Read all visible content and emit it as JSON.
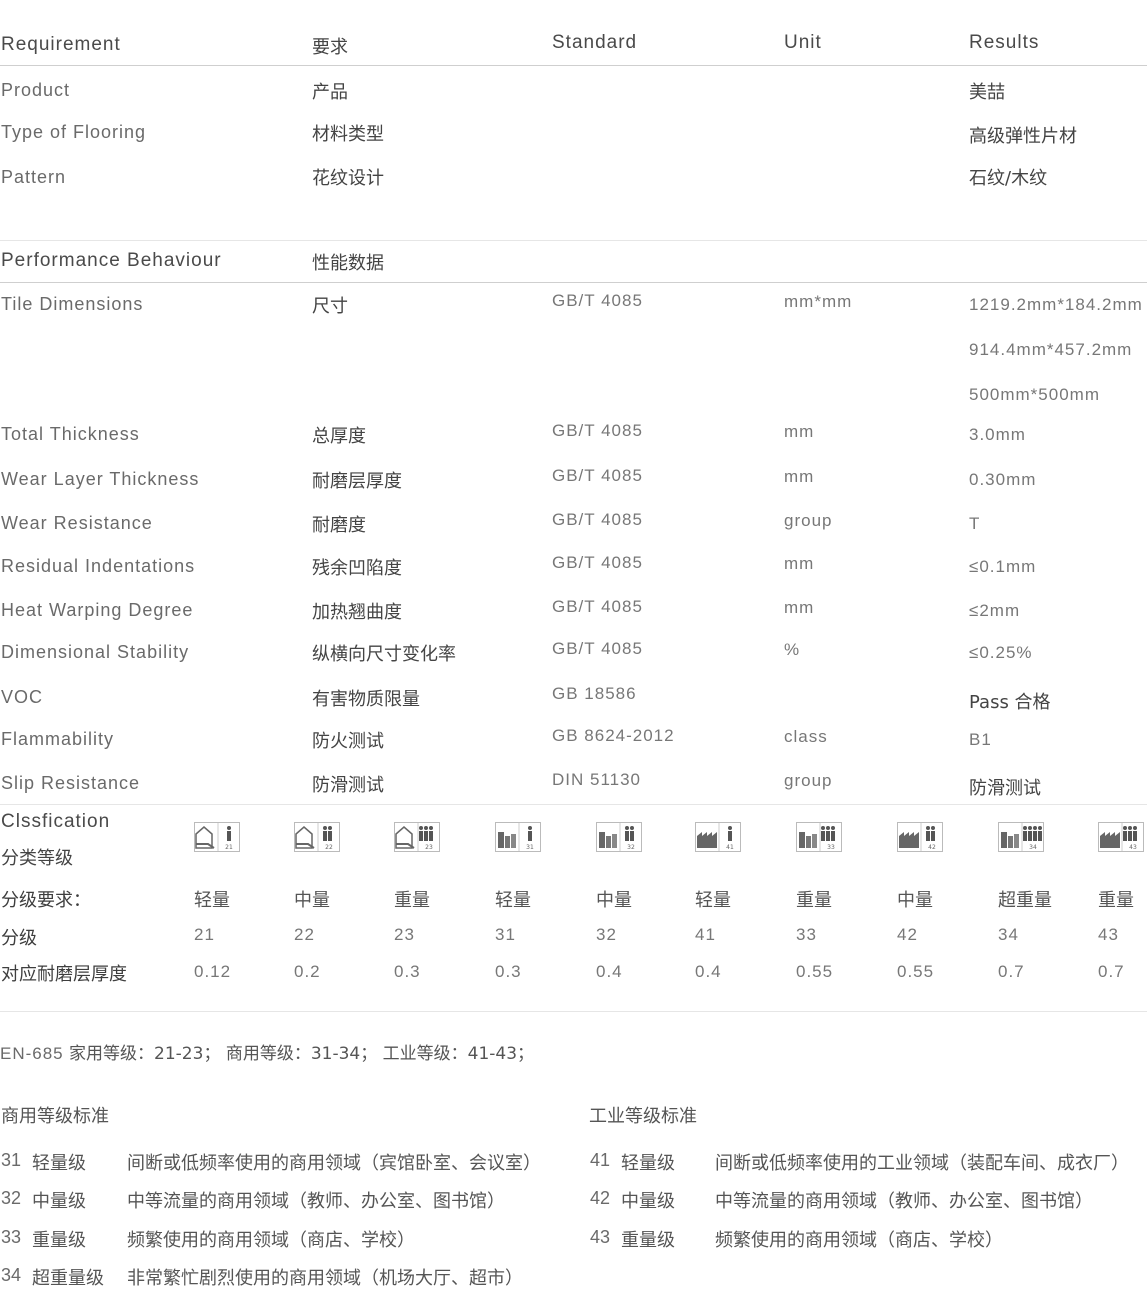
{
  "header": {
    "c1": "Requirement",
    "c2": "要求",
    "c3": "Standard",
    "c4": "Unit",
    "c5": "Results"
  },
  "basic": [
    {
      "en": "Product",
      "zh": "产品",
      "result": "美喆"
    },
    {
      "en": "Type of Flooring",
      "zh": "材料类型",
      "result": "高级弹性片材"
    },
    {
      "en": "Pattern",
      "zh": "花纹设计",
      "result": "石纹/木纹"
    }
  ],
  "perf_header": {
    "en": "Performance Behaviour",
    "zh": "性能数据"
  },
  "perf": [
    {
      "en": "Tile Dimensions",
      "zh": "尺寸",
      "std": "GB/T 4085",
      "unit": "mm*mm",
      "result": "1219.2mm*184.2mm"
    },
    {
      "result": "914.4mm*457.2mm"
    },
    {
      "result": "500mm*500mm"
    },
    {
      "en": "Total Thickness",
      "zh": "总厚度",
      "std": "GB/T 4085",
      "unit": "mm",
      "result": "3.0mm"
    },
    {
      "en": "Wear  Layer Thickness",
      "zh": "耐磨层厚度",
      "std": "GB/T 4085",
      "unit": "mm",
      "result": "0.30mm"
    },
    {
      "en": "Wear Resistance",
      "zh": "耐磨度",
      "std": "GB/T 4085",
      "unit": "group",
      "result": "T"
    },
    {
      "en": "Residual Indentations",
      "zh": "残余凹陷度",
      "std": "GB/T 4085",
      "unit": "mm",
      "result": "≤0.1mm"
    },
    {
      "en": "Heat Warping Degree",
      "zh": "加热翘曲度",
      "std": "GB/T 4085",
      "unit": "mm",
      "result": "≤2mm"
    },
    {
      "en": "Dimensional Stability",
      "zh": "纵横向尺寸变化率",
      "std": "GB/T 4085",
      "unit": "%",
      "result": "≤0.25%"
    },
    {
      "en": "VOC",
      "zh": "有害物质限量",
      "std": "GB 18586",
      "unit": "",
      "result": "Pass 合格"
    },
    {
      "en": "Flammability",
      "zh": "防火测试",
      "std": "GB 8624-2012",
      "unit": "class",
      "result": "B1"
    },
    {
      "en": "Slip Resistance",
      "zh": "防滑测试",
      "std": "DIN 51130",
      "unit": "group",
      "result": "防滑测试"
    }
  ],
  "classification": {
    "title_en": "Clssfication",
    "title_zh": "分类等级",
    "row_labels": {
      "req": "分级要求：",
      "grade": "分级",
      "wear": "对应耐磨层厚度"
    },
    "cols": [
      {
        "icon": "house-person-icon",
        "code": "21",
        "level": "轻量",
        "grade": "21",
        "wear": "0.12"
      },
      {
        "icon": "house-two-people-icon",
        "code": "22",
        "level": "中量",
        "grade": "22",
        "wear": "0.2"
      },
      {
        "icon": "house-group-icon",
        "code": "23",
        "level": "重量",
        "grade": "23",
        "wear": "0.3"
      },
      {
        "icon": "building-person-icon",
        "code": "31",
        "level": "轻量",
        "grade": "31",
        "wear": "0.3"
      },
      {
        "icon": "building-two-people-icon",
        "code": "32",
        "level": "中量",
        "grade": "32",
        "wear": "0.4"
      },
      {
        "icon": "factory-person-icon",
        "code": "41",
        "level": "轻量",
        "grade": "41",
        "wear": "0.4"
      },
      {
        "icon": "building-group-icon",
        "code": "33",
        "level": "重量",
        "grade": "33",
        "wear": "0.55"
      },
      {
        "icon": "factory-two-people-icon",
        "code": "42",
        "level": "中量",
        "grade": "42",
        "wear": "0.55"
      },
      {
        "icon": "building-crowd-icon",
        "code": "34",
        "level": "超重量",
        "grade": "34",
        "wear": "0.7"
      },
      {
        "icon": "factory-group-icon",
        "code": "43",
        "level": "重量",
        "grade": "43",
        "wear": "0.7"
      }
    ]
  },
  "en685": {
    "prefix": "EN-685",
    "text": " 家用等级：21-23； 商用等级：31-34； 工业等级：41-43；"
  },
  "commercial": {
    "title": "商用等级标准",
    "items": [
      {
        "num": "31",
        "name": "轻量级",
        "desc": "间断或低频率使用的商用领域（宾馆卧室、会议室）"
      },
      {
        "num": "32",
        "name": "中量级",
        "desc": "中等流量的商用领域（教师、办公室、图书馆）"
      },
      {
        "num": "33",
        "name": "重量级",
        "desc": "频繁使用的商用领域（商店、学校）"
      },
      {
        "num": "34",
        "name": "超重量级",
        "desc": "非常繁忙剧烈使用的商用领域（机场大厅、超市）"
      }
    ]
  },
  "industrial": {
    "title": "工业等级标准",
    "items": [
      {
        "num": "41",
        "name": "轻量级",
        "desc": "间断或低频率使用的工业领域（装配车间、成衣厂）"
      },
      {
        "num": "42",
        "name": "中量级",
        "desc": "中等流量的商用领域（教师、办公室、图书馆）"
      },
      {
        "num": "43",
        "name": "重量级",
        "desc": "频繁使用的商用领域（商店、学校）"
      }
    ]
  }
}
